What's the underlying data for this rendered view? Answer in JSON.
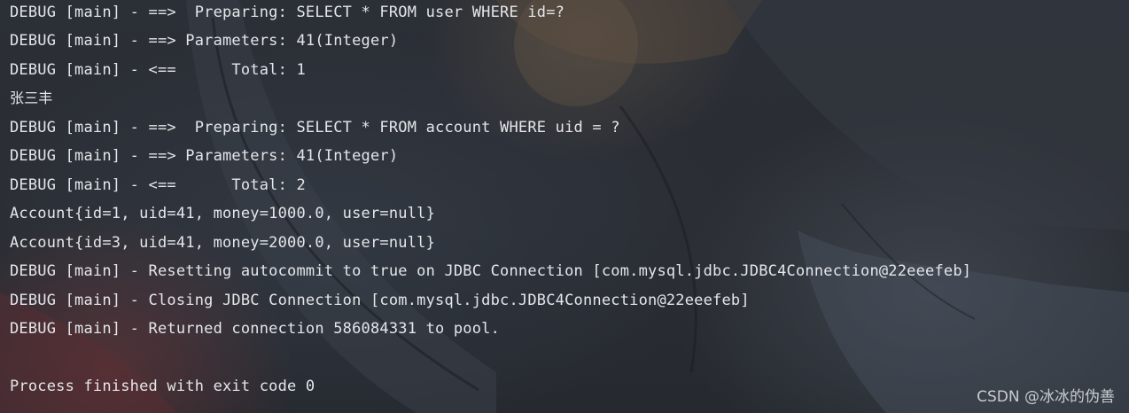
{
  "console": {
    "lines": [
      "DEBUG [main] - ==>  Preparing: SELECT * FROM user WHERE id=?",
      "DEBUG [main] - ==> Parameters: 41(Integer)",
      "DEBUG [main] - <==      Total: 1",
      "张三丰",
      "DEBUG [main] - ==>  Preparing: SELECT * FROM account WHERE uid = ?",
      "DEBUG [main] - ==> Parameters: 41(Integer)",
      "DEBUG [main] - <==      Total: 2",
      "Account{id=1, uid=41, money=1000.0, user=null}",
      "Account{id=3, uid=41, money=2000.0, user=null}",
      "DEBUG [main] - Resetting autocommit to true on JDBC Connection [com.mysql.jdbc.JDBC4Connection@22eeefeb]",
      "DEBUG [main] - Closing JDBC Connection [com.mysql.jdbc.JDBC4Connection@22eeefeb]",
      "DEBUG [main] - Returned connection 586084331 to pool.",
      "",
      "Process finished with exit code 0"
    ]
  },
  "watermark": "CSDN @冰冰的伪善",
  "colors": {
    "text": "#e4e6ea",
    "background": "#2b2d31",
    "watermark": "#c9cbd0"
  }
}
